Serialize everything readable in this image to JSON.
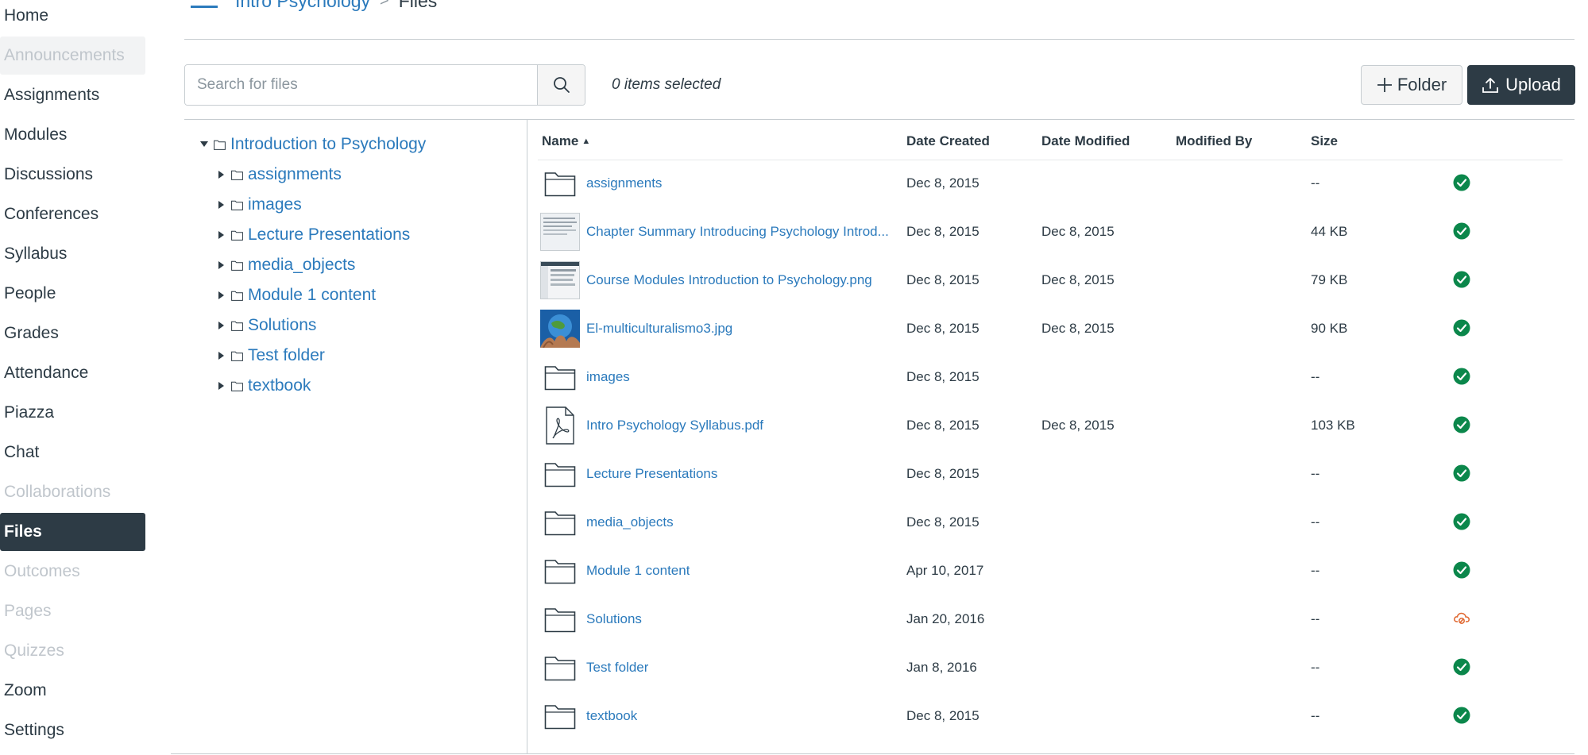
{
  "course_nav": {
    "items": [
      {
        "label": "Home",
        "state": "normal"
      },
      {
        "label": "Announcements",
        "state": "disabled"
      },
      {
        "label": "Assignments",
        "state": "normal"
      },
      {
        "label": "Modules",
        "state": "normal"
      },
      {
        "label": "Discussions",
        "state": "normal"
      },
      {
        "label": "Conferences",
        "state": "normal"
      },
      {
        "label": "Syllabus",
        "state": "normal"
      },
      {
        "label": "People",
        "state": "normal"
      },
      {
        "label": "Grades",
        "state": "normal"
      },
      {
        "label": "Attendance",
        "state": "normal"
      },
      {
        "label": "Piazza",
        "state": "normal"
      },
      {
        "label": "Chat",
        "state": "normal"
      },
      {
        "label": "Collaborations",
        "state": "disabled"
      },
      {
        "label": "Files",
        "state": "active"
      },
      {
        "label": "Outcomes",
        "state": "disabled"
      },
      {
        "label": "Pages",
        "state": "disabled"
      },
      {
        "label": "Quizzes",
        "state": "disabled"
      },
      {
        "label": "Zoom",
        "state": "normal"
      },
      {
        "label": "Settings",
        "state": "normal"
      }
    ]
  },
  "header": {
    "menu_icon": "hamburger-icon",
    "breadcrumb_course": "Intro Psychology",
    "breadcrumb_separator": ">",
    "breadcrumb_current": "Files"
  },
  "toolbar": {
    "search_placeholder": "Search for files",
    "search_icon": "search-icon",
    "selected_count": "0 items selected",
    "folder_button": "Folder",
    "upload_button": "Upload"
  },
  "tree": {
    "root": "Introduction to Psychology",
    "children": [
      "assignments",
      "images",
      "Lecture Presentations",
      "media_objects",
      "Module 1 content",
      "Solutions",
      "Test folder",
      "textbook"
    ]
  },
  "table": {
    "columns": {
      "name": "Name",
      "date_created": "Date Created",
      "date_modified": "Date Modified",
      "modified_by": "Modified By",
      "size": "Size"
    },
    "sort_indicator": "▲",
    "rows": [
      {
        "name": "assignments",
        "kind": "folder",
        "created": "Dec 8, 2015",
        "modified": "",
        "modified_by": "",
        "size": "--",
        "status": "published"
      },
      {
        "name": "Chapter Summary Introducing Psychology Introd...",
        "kind": "doc-thumb",
        "created": "Dec 8, 2015",
        "modified": "Dec 8, 2015",
        "modified_by": "",
        "size": "44 KB",
        "status": "published"
      },
      {
        "name": "Course Modules Introduction to Psychology.png",
        "kind": "screenshot-thumb",
        "created": "Dec 8, 2015",
        "modified": "Dec 8, 2015",
        "modified_by": "",
        "size": "79 KB",
        "status": "published"
      },
      {
        "name": "El-multiculturalismo3.jpg",
        "kind": "photo-thumb",
        "created": "Dec 8, 2015",
        "modified": "Dec 8, 2015",
        "modified_by": "",
        "size": "90 KB",
        "status": "published"
      },
      {
        "name": "images",
        "kind": "folder",
        "created": "Dec 8, 2015",
        "modified": "",
        "modified_by": "",
        "size": "--",
        "status": "published"
      },
      {
        "name": "Intro Psychology Syllabus.pdf",
        "kind": "pdf",
        "created": "Dec 8, 2015",
        "modified": "Dec 8, 2015",
        "modified_by": "",
        "size": "103 KB",
        "status": "published"
      },
      {
        "name": "Lecture Presentations",
        "kind": "folder",
        "created": "Dec 8, 2015",
        "modified": "",
        "modified_by": "",
        "size": "--",
        "status": "published"
      },
      {
        "name": "media_objects",
        "kind": "folder",
        "created": "Dec 8, 2015",
        "modified": "",
        "modified_by": "",
        "size": "--",
        "status": "published"
      },
      {
        "name": "Module 1 content",
        "kind": "folder",
        "created": "Apr 10, 2017",
        "modified": "",
        "modified_by": "",
        "size": "--",
        "status": "published"
      },
      {
        "name": "Solutions",
        "kind": "folder",
        "created": "Jan 20, 2016",
        "modified": "",
        "modified_by": "",
        "size": "--",
        "status": "unpublished"
      },
      {
        "name": "Test folder",
        "kind": "folder",
        "created": "Jan 8, 2016",
        "modified": "",
        "modified_by": "",
        "size": "--",
        "status": "published"
      },
      {
        "name": "textbook",
        "kind": "folder",
        "created": "Dec 8, 2015",
        "modified": "",
        "modified_by": "",
        "size": "--",
        "status": "published"
      }
    ]
  },
  "colors": {
    "link": "#2b7abc",
    "text": "#2d3b45",
    "published": "#0b874b",
    "unpublished": "#e0662e",
    "active_nav": "#2d3b45"
  }
}
